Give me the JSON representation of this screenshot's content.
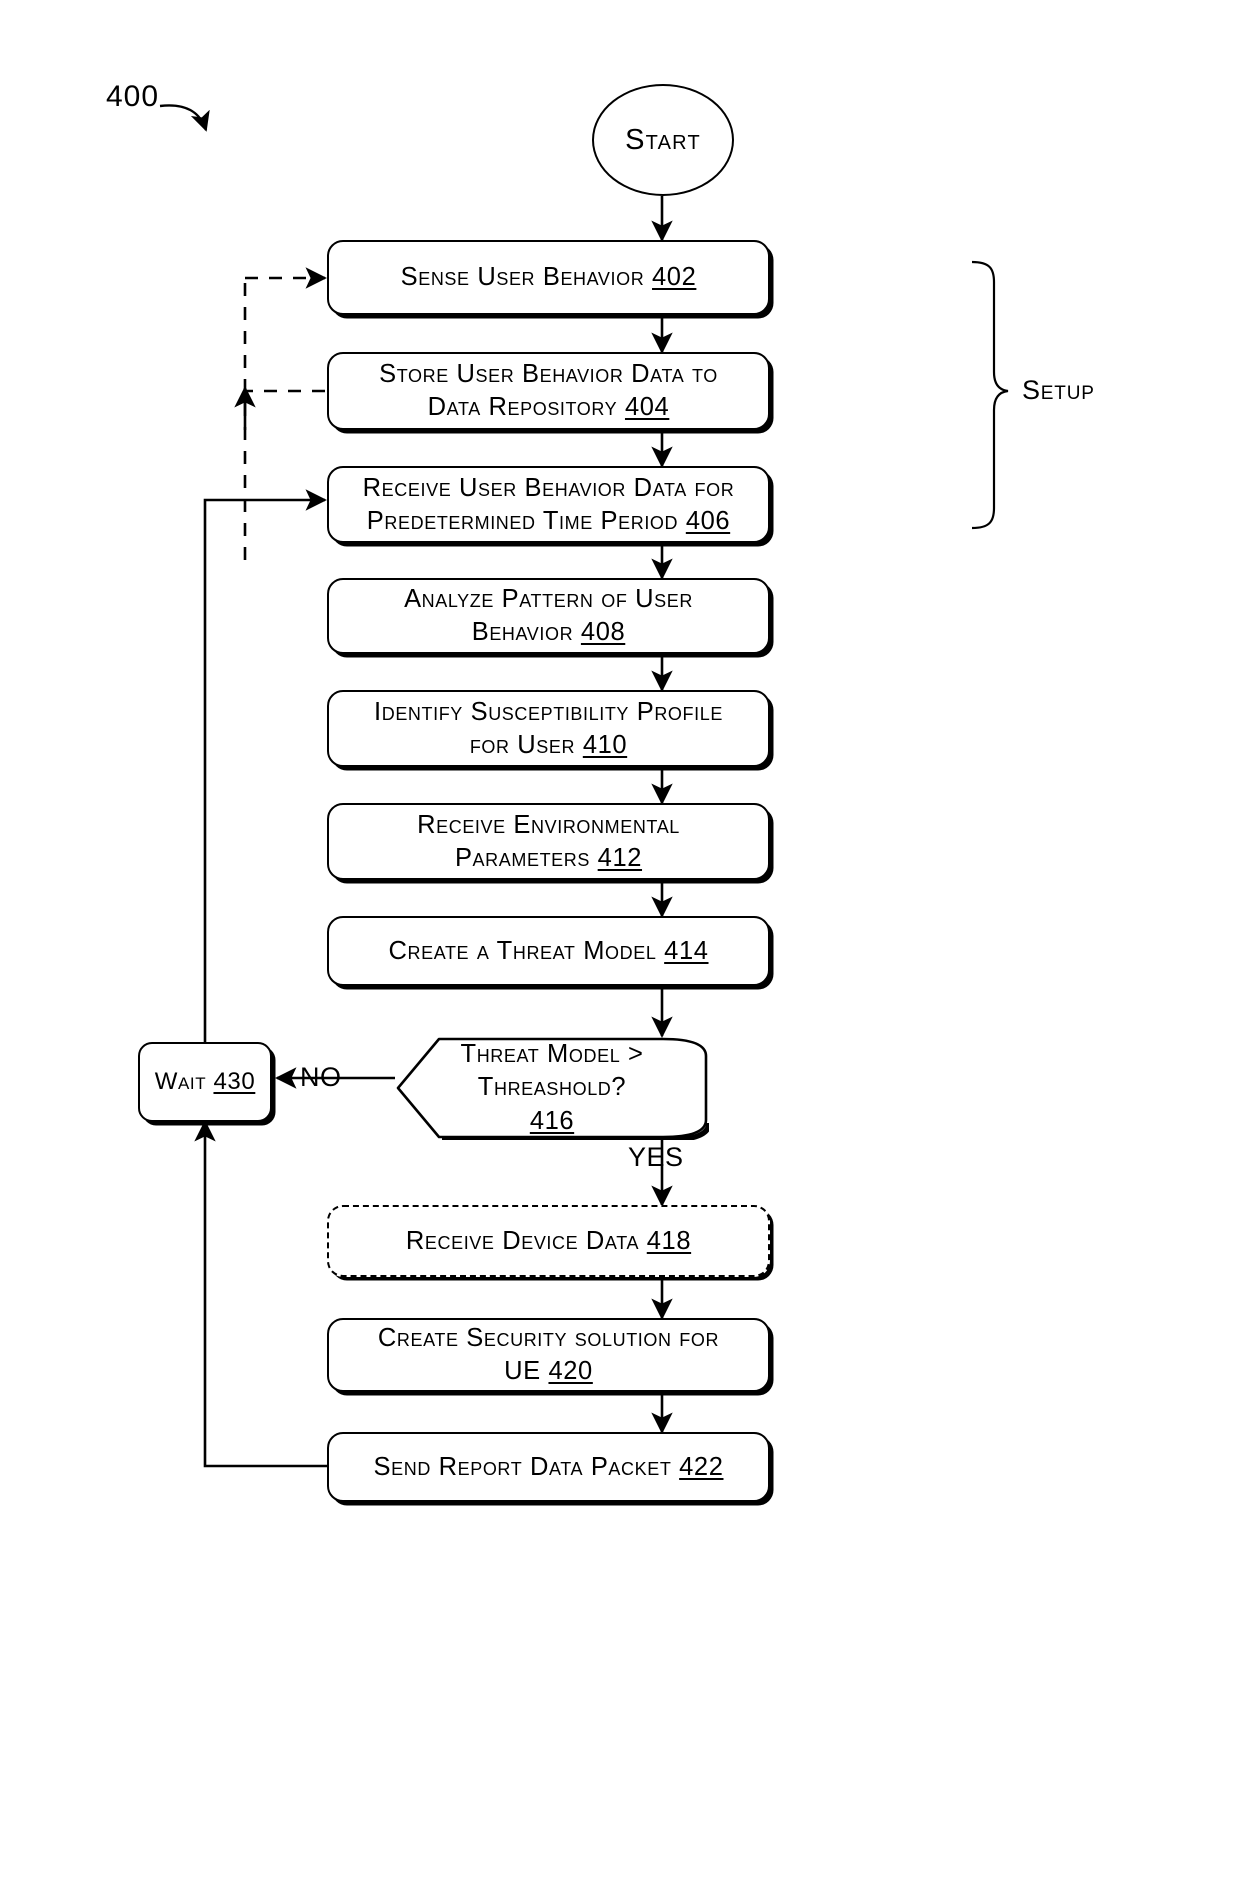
{
  "figure": {
    "number": "400",
    "bracket_label": "Setup"
  },
  "nodes": {
    "start": {
      "label": "Start",
      "shape": "terminator"
    },
    "n402": {
      "text": "Sense User Behavior ",
      "ref": "402",
      "shape": "process"
    },
    "n404": {
      "text": "Store User Behavior Data to\nData Repository ",
      "ref": "404",
      "shape": "process"
    },
    "n406": {
      "text": "Receive User Behavior Data for\nPredetermined Time Period ",
      "ref": "406",
      "shape": "process"
    },
    "n408": {
      "text": "Analyze Pattern of User\nBehavior ",
      "ref": "408",
      "shape": "process"
    },
    "n410": {
      "text": "Identify Susceptibility Profile\nfor User ",
      "ref": "410",
      "shape": "process"
    },
    "n412": {
      "text": "Receive Environmental\nParameters ",
      "ref": "412",
      "shape": "process"
    },
    "n414": {
      "text": "Create a Threat Model ",
      "ref": "414",
      "shape": "process"
    },
    "n416": {
      "line1": "Threat Model >",
      "line2": "Threashold?",
      "ref": "416",
      "shape": "decision"
    },
    "n418": {
      "text": "Receive Device Data ",
      "ref": "418",
      "shape": "process-dashed"
    },
    "n420": {
      "text": "Create Security solution for\nUE ",
      "ref": "420",
      "shape": "process"
    },
    "n422": {
      "text": "Send Report Data Packet ",
      "ref": "422",
      "shape": "process"
    },
    "n430": {
      "text": "Wait ",
      "ref": "430",
      "shape": "process"
    }
  },
  "edge_labels": {
    "no": "NO",
    "yes": "YES"
  },
  "colors": {
    "line": "#000000",
    "fill": "#ffffff",
    "text": "#000000"
  }
}
